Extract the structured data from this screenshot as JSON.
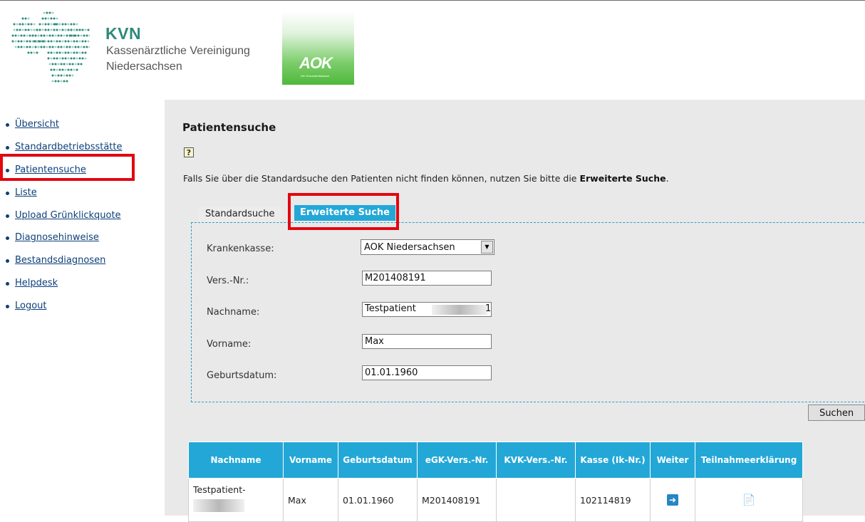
{
  "header": {
    "kvn_short": "KVN",
    "kvn_line1": "Kassenärztliche Vereinigung",
    "kvn_line2": "Niedersachsen",
    "aok_logo": "AOK",
    "aok_tagline": "Die Gesundheitskasse."
  },
  "nav": {
    "items": [
      {
        "label": "Übersicht"
      },
      {
        "label": "Standardbetriebsstätte"
      },
      {
        "label": "Patientensuche"
      },
      {
        "label": "Liste"
      },
      {
        "label": "Upload Grünklickquote"
      },
      {
        "label": "Diagnosehinweise"
      },
      {
        "label": "Bestandsdiagnosen"
      },
      {
        "label": "Helpdesk"
      },
      {
        "label": "Logout"
      }
    ]
  },
  "main": {
    "title": "Patientensuche",
    "help_symbol": "?",
    "info_prefix": "Falls Sie über die Standardsuche den Patienten nicht finden können, nutzen Sie bitte die ",
    "info_link": "Erweiterte Suche",
    "info_suffix": "."
  },
  "tabs": {
    "standard": "Standardsuche",
    "extended": "Erweiterte Suche"
  },
  "form": {
    "krankenkasse_label": "Krankenkasse:",
    "krankenkasse_value": "AOK Niedersachsen",
    "versnr_label": "Vers.-Nr.:",
    "versnr_value": "M201408191",
    "nachname_label": "Nachname:",
    "nachname_value": "Testpatient",
    "nachname_suffix": "1",
    "vorname_label": "Vorname:",
    "vorname_value": "Max",
    "geburtsdatum_label": "Geburtsdatum:",
    "geburtsdatum_value": "01.01.1960",
    "search_button": "Suchen"
  },
  "results": {
    "columns": [
      "Nachname",
      "Vorname",
      "Geburtsdatum",
      "eGK-Vers.-Nr.",
      "KVK-Vers.-Nr.",
      "Kasse (Ik-Nr.)",
      "Weiter",
      "Teilnahmeerklärung"
    ],
    "rows": [
      {
        "nachname": "Testpatient-",
        "vorname": "Max",
        "geburtsdatum": "01.01.1960",
        "egk": "M201408191",
        "kvk": "",
        "kasse": "102114819",
        "weiter_icon": "arrow-right-icon",
        "teilnahme_icon": "pdf-icon"
      }
    ]
  },
  "colors": {
    "accent": "#23a7d7",
    "highlight": "#e3070f",
    "kvn_green": "#2d8a79",
    "nav_link": "#0d3f7a"
  }
}
